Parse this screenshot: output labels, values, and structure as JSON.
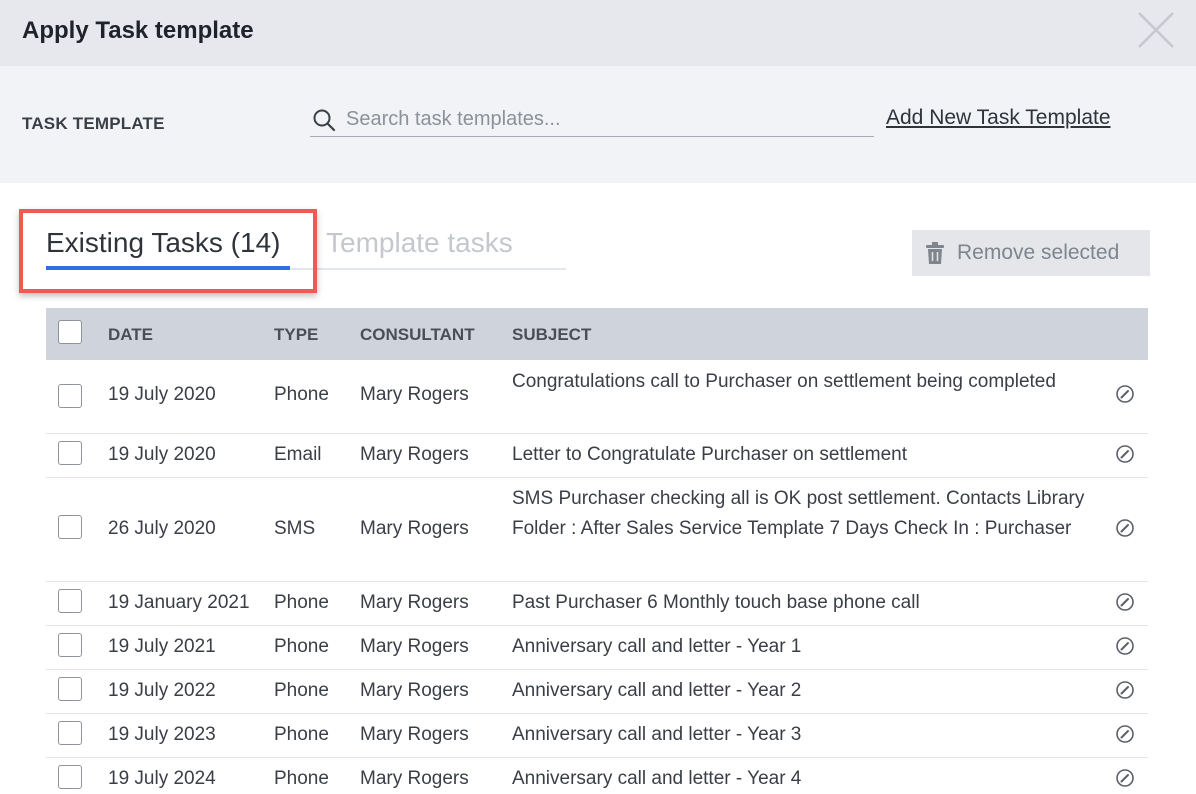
{
  "dialog": {
    "title": "Apply Task template",
    "close_icon": "close-icon"
  },
  "template_bar": {
    "label": "TASK TEMPLATE",
    "search_placeholder": "Search task templates...",
    "search_value": "",
    "add_link": "Add New Task Template"
  },
  "tabs": {
    "existing": "Existing Tasks (14)",
    "template": "Template tasks",
    "active": "existing"
  },
  "actions": {
    "remove_selected": "Remove selected"
  },
  "colors": {
    "accent": "#2f6fe0",
    "highlight": "#ee5b50"
  },
  "table": {
    "headers": {
      "date": "DATE",
      "type": "TYPE",
      "consultant": "CONSULTANT",
      "subject": "SUBJECT"
    },
    "rows": [
      {
        "date": "19 July 2020",
        "type": "Phone",
        "consultant": "Mary Rogers",
        "subject": "Congratulations call to Purchaser on settlement being completed"
      },
      {
        "date": "19 July 2020",
        "type": "Email",
        "consultant": "Mary Rogers",
        "subject": "Letter to Congratulate Purchaser on settlement"
      },
      {
        "date": "26 July 2020",
        "type": "SMS",
        "consultant": "Mary Rogers",
        "subject": "SMS Purchaser checking all is OK post settlement. Contacts Library Folder : After Sales Service Template 7 Days Check In : Purchaser"
      },
      {
        "date": "19 January 2021",
        "type": "Phone",
        "consultant": "Mary Rogers",
        "subject": "Past Purchaser 6 Monthly touch base phone call"
      },
      {
        "date": "19 July 2021",
        "type": "Phone",
        "consultant": "Mary Rogers",
        "subject": "Anniversary call and letter - Year 1"
      },
      {
        "date": "19 July 2022",
        "type": "Phone",
        "consultant": "Mary Rogers",
        "subject": "Anniversary call and letter - Year 2"
      },
      {
        "date": "19 July 2023",
        "type": "Phone",
        "consultant": "Mary Rogers",
        "subject": "Anniversary call and letter - Year 3"
      },
      {
        "date": "19 July 2024",
        "type": "Phone",
        "consultant": "Mary Rogers",
        "subject": "Anniversary call and letter - Year 4"
      }
    ]
  }
}
